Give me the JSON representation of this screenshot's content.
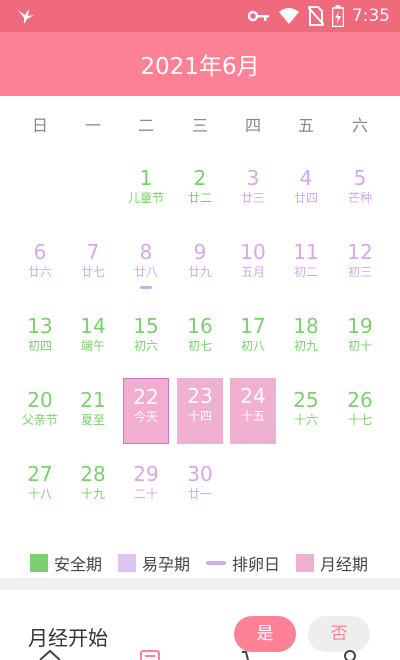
{
  "status_bar": {
    "time": "7:35",
    "icons": [
      "app-bird-icon",
      "key-icon",
      "wifi-icon",
      "no-sim-icon",
      "battery-icon"
    ]
  },
  "header": {
    "title": "2021年6月"
  },
  "weekdays": [
    "日",
    "一",
    "二",
    "三",
    "四",
    "五",
    "六"
  ],
  "days": [
    {
      "num": "1",
      "lunar": "儿童节",
      "type": "safe"
    },
    {
      "num": "2",
      "lunar": "廿二",
      "type": "safe"
    },
    {
      "num": "3",
      "lunar": "廿三",
      "type": "fertile"
    },
    {
      "num": "4",
      "lunar": "廿四",
      "type": "fertile"
    },
    {
      "num": "5",
      "lunar": "芒种",
      "type": "fertile"
    },
    {
      "num": "6",
      "lunar": "廿六",
      "type": "fertile"
    },
    {
      "num": "7",
      "lunar": "廿七",
      "type": "fertile"
    },
    {
      "num": "8",
      "lunar": "廿八",
      "type": "fertile",
      "ovulation": true
    },
    {
      "num": "9",
      "lunar": "廿九",
      "type": "fertile"
    },
    {
      "num": "10",
      "lunar": "五月",
      "type": "fertile"
    },
    {
      "num": "11",
      "lunar": "初二",
      "type": "fertile"
    },
    {
      "num": "12",
      "lunar": "初三",
      "type": "fertile"
    },
    {
      "num": "13",
      "lunar": "初四",
      "type": "safe"
    },
    {
      "num": "14",
      "lunar": "端午",
      "type": "safe"
    },
    {
      "num": "15",
      "lunar": "初六",
      "type": "safe"
    },
    {
      "num": "16",
      "lunar": "初七",
      "type": "safe"
    },
    {
      "num": "17",
      "lunar": "初八",
      "type": "safe"
    },
    {
      "num": "18",
      "lunar": "初九",
      "type": "safe"
    },
    {
      "num": "19",
      "lunar": "初十",
      "type": "safe"
    },
    {
      "num": "20",
      "lunar": "父亲节",
      "type": "safe"
    },
    {
      "num": "21",
      "lunar": "夏至",
      "type": "safe"
    },
    {
      "num": "22",
      "lunar": "今天",
      "type": "period",
      "today": true
    },
    {
      "num": "23",
      "lunar": "十四",
      "type": "period"
    },
    {
      "num": "24",
      "lunar": "十五",
      "type": "period"
    },
    {
      "num": "25",
      "lunar": "十六",
      "type": "safe"
    },
    {
      "num": "26",
      "lunar": "十七",
      "type": "safe"
    },
    {
      "num": "27",
      "lunar": "十八",
      "type": "safe"
    },
    {
      "num": "28",
      "lunar": "十九",
      "type": "safe"
    },
    {
      "num": "29",
      "lunar": "二十",
      "type": "fertile"
    },
    {
      "num": "30",
      "lunar": "廿一",
      "type": "fertile"
    }
  ],
  "legend": {
    "safe": "安全期",
    "fertile": "易孕期",
    "ovulation": "排卵日",
    "period": "月经期"
  },
  "period_start": {
    "label": "月经开始",
    "yes": "是",
    "no": "否"
  },
  "colors": {
    "brand": "#fe8196",
    "safe": "#7ccf6e",
    "fertile": "#d7a8e8",
    "period": "#f0b0d2"
  },
  "nav_icons": [
    "home-icon",
    "calendar-icon",
    "cart-icon",
    "profile-icon"
  ]
}
